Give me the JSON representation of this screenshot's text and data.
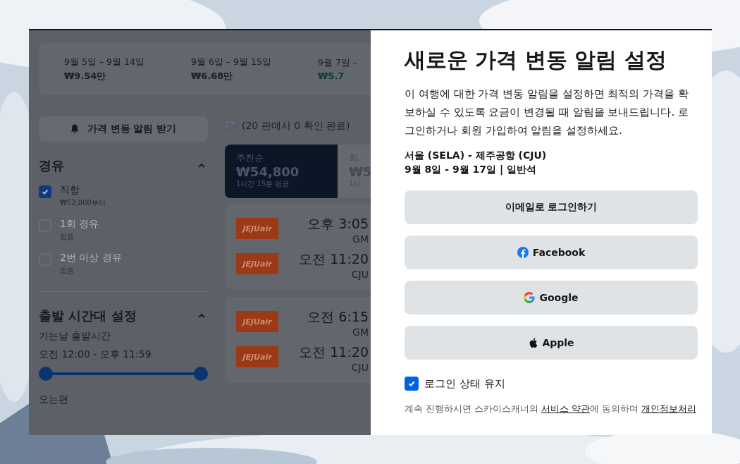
{
  "date_strip": [
    {
      "dates": "9월 5일 – 9월 14일",
      "price": "₩9.54만",
      "cheapest": false
    },
    {
      "dates": "9월 6일 – 9월 15일",
      "price": "₩6.68만",
      "cheapest": false
    },
    {
      "dates": "9월 7일 –",
      "price": "₩5.7",
      "cheapest": true
    }
  ],
  "alert_button": {
    "label": "가격 변동 알림 받기"
  },
  "progress": {
    "text": "(20 판매사 0 확인 완료)"
  },
  "stops": {
    "title": "경유",
    "expanded": true,
    "options": [
      {
        "label": "직항",
        "note": "₩52,800부터",
        "checked": true,
        "disabled": false
      },
      {
        "label": "1회 경유",
        "note": "없음",
        "checked": false,
        "disabled": true
      },
      {
        "label": "2번 이상 경유",
        "note": "없음",
        "checked": false,
        "disabled": true
      }
    ]
  },
  "departure_times": {
    "title": "출발 시간대 설정",
    "expanded": true,
    "outbound_label": "가는날 출발시간",
    "outbound_range": "오전 12:00 - 오후 11:59",
    "range_thumbs": [
      {
        "level": 0
      },
      {
        "level": 1
      }
    ],
    "return_label": "오는편"
  },
  "sort_tabs": [
    {
      "label": "추천순",
      "price": "₩54,800",
      "note": "1시간 15분 평균",
      "selected": true
    },
    {
      "label": "최",
      "price": "₩5",
      "note": "1시",
      "selected": false
    }
  ],
  "results": [
    {
      "legs": [
        {
          "airline": "JEJUair",
          "time": "오후 3:05",
          "airport": "GM"
        },
        {
          "airline": "JEJUair",
          "time": "오전 11:20",
          "airport": "CJU"
        }
      ]
    },
    {
      "legs": [
        {
          "airline": "JEJUair",
          "time": "오전 6:15",
          "airport": "GM"
        },
        {
          "airline": "JEJUair",
          "time": "오전 11:20",
          "airport": "CJU"
        }
      ]
    }
  ],
  "modal": {
    "title": "새로운 가격 변동 알림 설정",
    "description": "이 여행에 대한 가격 변동 알림을 설정하면 최적의 가격을 확보하실 수 있도록 요금이 변경될 때 알림을 보내드립니다. 로그인하거나 회원 가입하여 알림을 설정하세요.",
    "route": "서울 (SELA) - 제주공항 (CJU)",
    "trip": "9월 8일 - 9월 17일 | 일반석",
    "buttons": [
      {
        "kind": "email",
        "label": "이메일로 로그인하기"
      },
      {
        "kind": "facebook",
        "label": "Facebook"
      },
      {
        "kind": "google",
        "label": "Google"
      },
      {
        "kind": "apple",
        "label": "Apple"
      }
    ],
    "keep_signed_in": {
      "label": "로그인 상태 유지",
      "checked": true
    },
    "terms": {
      "before": "계속 진행하시면 스카이스캐너의 ",
      "link1": "서비스 약관",
      "middle": "에 동의하며 ",
      "link2": "개인정보처리"
    }
  }
}
